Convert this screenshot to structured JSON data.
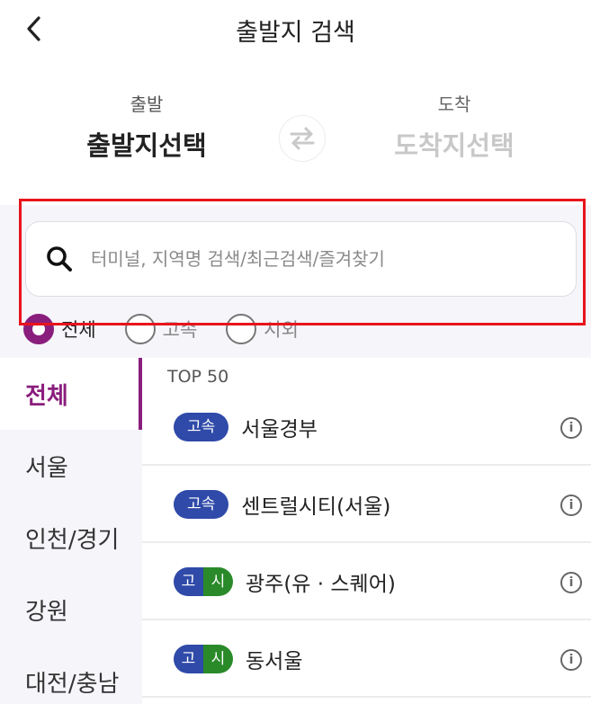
{
  "header": {
    "title": "출발지 검색",
    "back_icon": "chevron-left-icon"
  },
  "route": {
    "departure_label": "출발",
    "departure_value": "출발지선택",
    "arrival_label": "도착",
    "arrival_value": "도착지선택",
    "swap_icon": "swap-arrows-icon"
  },
  "search": {
    "placeholder": "터미널, 지역명 검색/최근검색/즐겨찾기",
    "value": "",
    "icon": "search-icon"
  },
  "filters": [
    {
      "label": "전체",
      "selected": true
    },
    {
      "label": "고속",
      "selected": false
    },
    {
      "label": "시외",
      "selected": false
    }
  ],
  "sidebar": {
    "items": [
      {
        "label": "전체",
        "active": true
      },
      {
        "label": "서울",
        "active": false
      },
      {
        "label": "인천/경기",
        "active": false
      },
      {
        "label": "강원",
        "active": false
      },
      {
        "label": "대전/충남",
        "active": false
      }
    ]
  },
  "list": {
    "section_label": "TOP 50",
    "items": [
      {
        "badge": [
          "고속"
        ],
        "name": "서울경부"
      },
      {
        "badge": [
          "고속"
        ],
        "name": "센트럴시티(서울)"
      },
      {
        "badge": [
          "고",
          "시"
        ],
        "name": "광주(유 · 스퀘어)"
      },
      {
        "badge": [
          "고",
          "시"
        ],
        "name": "동서울"
      }
    ]
  },
  "colors": {
    "accent": "#8a1e7d",
    "express_badge": "#2f4aa8",
    "intercity_badge": "#2a8a2a",
    "highlight_box": "#e8141c"
  }
}
